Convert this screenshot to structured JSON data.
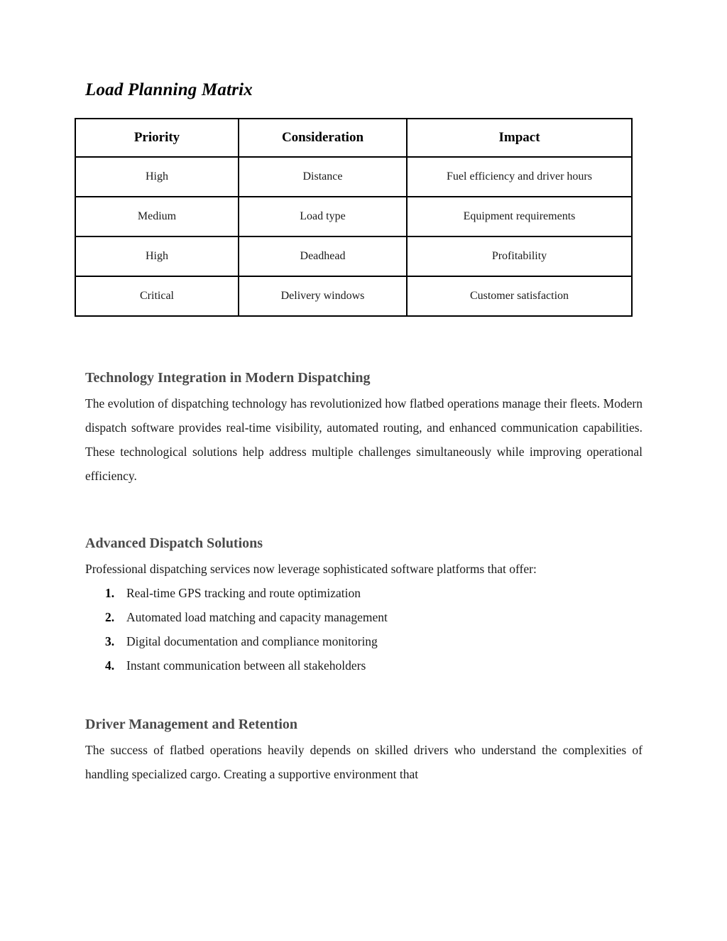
{
  "document": {
    "title": "Load Planning Matrix"
  },
  "table": {
    "caption": "Load Planning Matrix",
    "headers": [
      "Priority",
      "Consideration",
      "Impact"
    ],
    "rows": [
      [
        "High",
        "Distance",
        "Fuel efficiency and driver hours"
      ],
      [
        "Medium",
        "Load type",
        "Equipment requirements"
      ],
      [
        "High",
        "Deadhead",
        "Profitability"
      ],
      [
        "Critical",
        "Delivery windows",
        "Customer satisfaction"
      ]
    ]
  },
  "sections": [
    {
      "heading": "Technology Integration in Modern Dispatching",
      "paragraph": "The evolution of dispatching technology has revolutionized how flatbed operations manage their fleets. Modern dispatch software provides real-time visibility, automated routing, and enhanced communication capabilities. These technological solutions help address multiple challenges simultaneously while improving operational efficiency."
    },
    {
      "heading": "Advanced Dispatch Solutions",
      "paragraph": "Professional dispatching services now leverage sophisticated software platforms that offer:",
      "list": [
        {
          "number": "1.",
          "text": "Real-time GPS tracking and route optimization"
        },
        {
          "number": "2.",
          "text": "Automated load matching and capacity management"
        },
        {
          "number": "3.",
          "text": "Digital documentation and compliance monitoring"
        },
        {
          "number": "4.",
          "text": "Instant communication between all stakeholders"
        }
      ]
    },
    {
      "heading": "Driver Management and Retention",
      "paragraph": "The success of flatbed operations heavily depends on skilled drivers who understand the complexities of handling specialized cargo. Creating a supportive environment that"
    }
  ],
  "colors": {
    "heading": "#4a4a4a",
    "body": "#1a1a1a",
    "border": "#000000",
    "background": "#ffffff"
  }
}
